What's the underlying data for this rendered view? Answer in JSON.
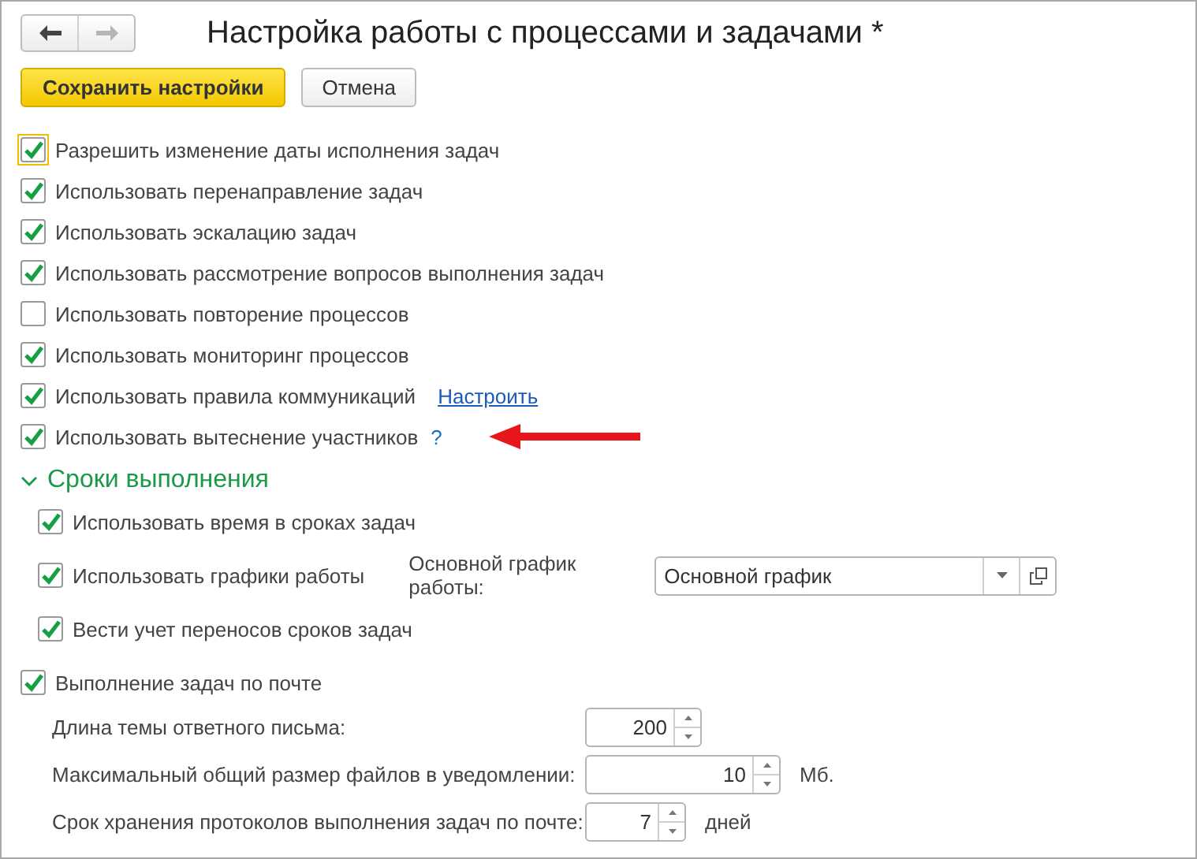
{
  "window": {
    "title": "Настройка работы с процессами и задачами *"
  },
  "nav": {
    "back_disabled": false,
    "forward_disabled": true
  },
  "buttons": [
    {
      "label": "Сохранить настройки",
      "kind": "primary"
    },
    {
      "label": "Отмена",
      "kind": "plain"
    }
  ],
  "options": [
    {
      "label": "Разрешить изменение даты исполнения задач",
      "checked": true,
      "focused": true
    },
    {
      "label": "Использовать перенаправление задач",
      "checked": true,
      "focused": false
    },
    {
      "label": "Использовать эскалацию задач",
      "checked": true,
      "focused": false
    },
    {
      "label": "Использовать рассмотрение вопросов выполнения задач",
      "checked": true,
      "focused": false
    },
    {
      "label": "Использовать повторение процессов",
      "checked": false,
      "focused": false
    },
    {
      "label": "Использовать мониторинг процессов",
      "checked": true,
      "focused": false
    },
    {
      "label": "Использовать правила коммуникаций",
      "checked": true,
      "focused": false,
      "link": "Настроить"
    },
    {
      "label": "Использовать вытеснение участников",
      "checked": true,
      "focused": false,
      "help": "?",
      "annotated": true
    }
  ],
  "section": {
    "title": "Сроки выполнения",
    "expanded": true,
    "items": [
      {
        "label": "Использовать время в сроках задач",
        "checked": true
      },
      {
        "label": "Использовать графики работы",
        "checked": true,
        "field_label": "Основной график работы:",
        "field_value": "Основной график"
      },
      {
        "label": "Вести учет переносов сроков задач",
        "checked": true
      }
    ]
  },
  "mail": {
    "label": "Выполнение задач по почте",
    "checked": true,
    "fields": [
      {
        "label": "Длина темы ответного письма:",
        "value": "200"
      },
      {
        "label": "Максимальный общий размер файлов в уведомлении:",
        "value": "10",
        "unit": "Мб."
      },
      {
        "label": "Срок хранения протоколов выполнения задач по почте:",
        "value": "7",
        "unit": "дней"
      }
    ]
  }
}
